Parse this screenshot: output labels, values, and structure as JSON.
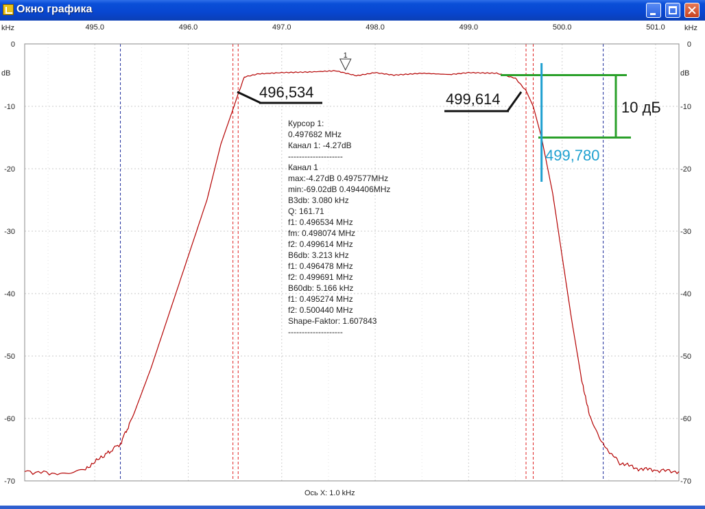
{
  "window": {
    "title": "Окно графика"
  },
  "axis": {
    "unit_top": "kHz",
    "unit_side": "dB",
    "x_caption": "Ось X: 1.0 kHz",
    "x_ticks": [
      {
        "label": "495.0",
        "value": 495.0
      },
      {
        "label": "496.0",
        "value": 496.0
      },
      {
        "label": "497.0",
        "value": 497.0
      },
      {
        "label": "498.0",
        "value": 498.0
      },
      {
        "label": "499.0",
        "value": 499.0
      },
      {
        "label": "500.0",
        "value": 500.0
      },
      {
        "label": "501.0",
        "value": 501.0
      }
    ],
    "y_ticks": [
      {
        "label": "0",
        "value": 0
      },
      {
        "label": "-10",
        "value": -10
      },
      {
        "label": "-20",
        "value": -20
      },
      {
        "label": "-30",
        "value": -30
      },
      {
        "label": "-40",
        "value": -40
      },
      {
        "label": "-50",
        "value": -50
      },
      {
        "label": "-60",
        "value": -60
      },
      {
        "label": "-70",
        "value": -70
      }
    ],
    "x_range": [
      494.25,
      501.25
    ],
    "y_range": [
      -70,
      0
    ]
  },
  "cursor": {
    "label": "1",
    "x": 497.682
  },
  "markers": {
    "blue_dashed": [
      495.274,
      500.44
    ],
    "red_dashed": [
      496.478,
      496.534,
      499.614,
      499.691
    ]
  },
  "info_lines": [
    "Курсор 1:",
    "0.497682 MHz",
    "Канал 1:  -4.27dB",
    "--------------------",
    "Канал 1",
    "max:-4.27dB 0.497577MHz",
    "min:-69.02dB 0.494406MHz",
    "B3db: 3.080 kHz",
    "Q: 161.71",
    "f1: 0.496534 MHz",
    "fm: 0.498074 MHz",
    "f2: 0.499614 MHz",
    "B6db: 3.213 kHz",
    "f1: 0.496478 MHz",
    "f2: 0.499691 MHz",
    "B60db: 5.166 kHz",
    "f1: 0.495274 MHz",
    "f2: 0.500440 MHz",
    "Shape-Faktor: 1.607843",
    "--------------------"
  ],
  "annotations": {
    "left_freq": "496,534",
    "right_freq": "499,614",
    "blue_freq": "499,780",
    "db_span": "10 дБ",
    "blue_x": 499.78,
    "green_top_db": -5,
    "green_bottom_db": -15
  },
  "colors": {
    "trace": "#b40000",
    "grid": "#c8c8c8",
    "red_marker": "#e02020",
    "blue_marker": "#1a2a9a",
    "annotation_blue": "#1ea0d0",
    "annotation_green": "#2aa02a"
  },
  "chart_data": {
    "type": "line",
    "xlabel": "Ось X: 1.0 kHz",
    "ylabel": "dB",
    "xlim": [
      494.25,
      501.25
    ],
    "ylim": [
      -70,
      0
    ],
    "grid": true,
    "series": [
      {
        "x": [
          494.25,
          494.6,
          494.9,
          495.1,
          495.274,
          495.4,
          495.6,
          495.8,
          496.0,
          496.2,
          496.35,
          496.478,
          496.534,
          496.6,
          496.75,
          497.0,
          497.3,
          497.577,
          497.8,
          498.0,
          498.2,
          498.5,
          498.8,
          499.0,
          499.3,
          499.5,
          499.614,
          499.691,
          499.78,
          499.9,
          500.0,
          500.1,
          500.2,
          500.3,
          500.44,
          500.6,
          500.8,
          501.0,
          501.25
        ],
        "y": [
          -68.5,
          -68.8,
          -68,
          -66,
          -64,
          -60,
          -52,
          -43,
          -34,
          -25,
          -16,
          -10.5,
          -8,
          -5.3,
          -4.8,
          -4.6,
          -4.5,
          -4.3,
          -5.1,
          -4.6,
          -5.0,
          -4.7,
          -4.9,
          -4.6,
          -4.7,
          -5.5,
          -7.5,
          -10,
          -15,
          -24,
          -34,
          -44,
          -53,
          -60,
          -64,
          -67,
          -68,
          -68.3,
          -68.5
        ]
      }
    ]
  }
}
